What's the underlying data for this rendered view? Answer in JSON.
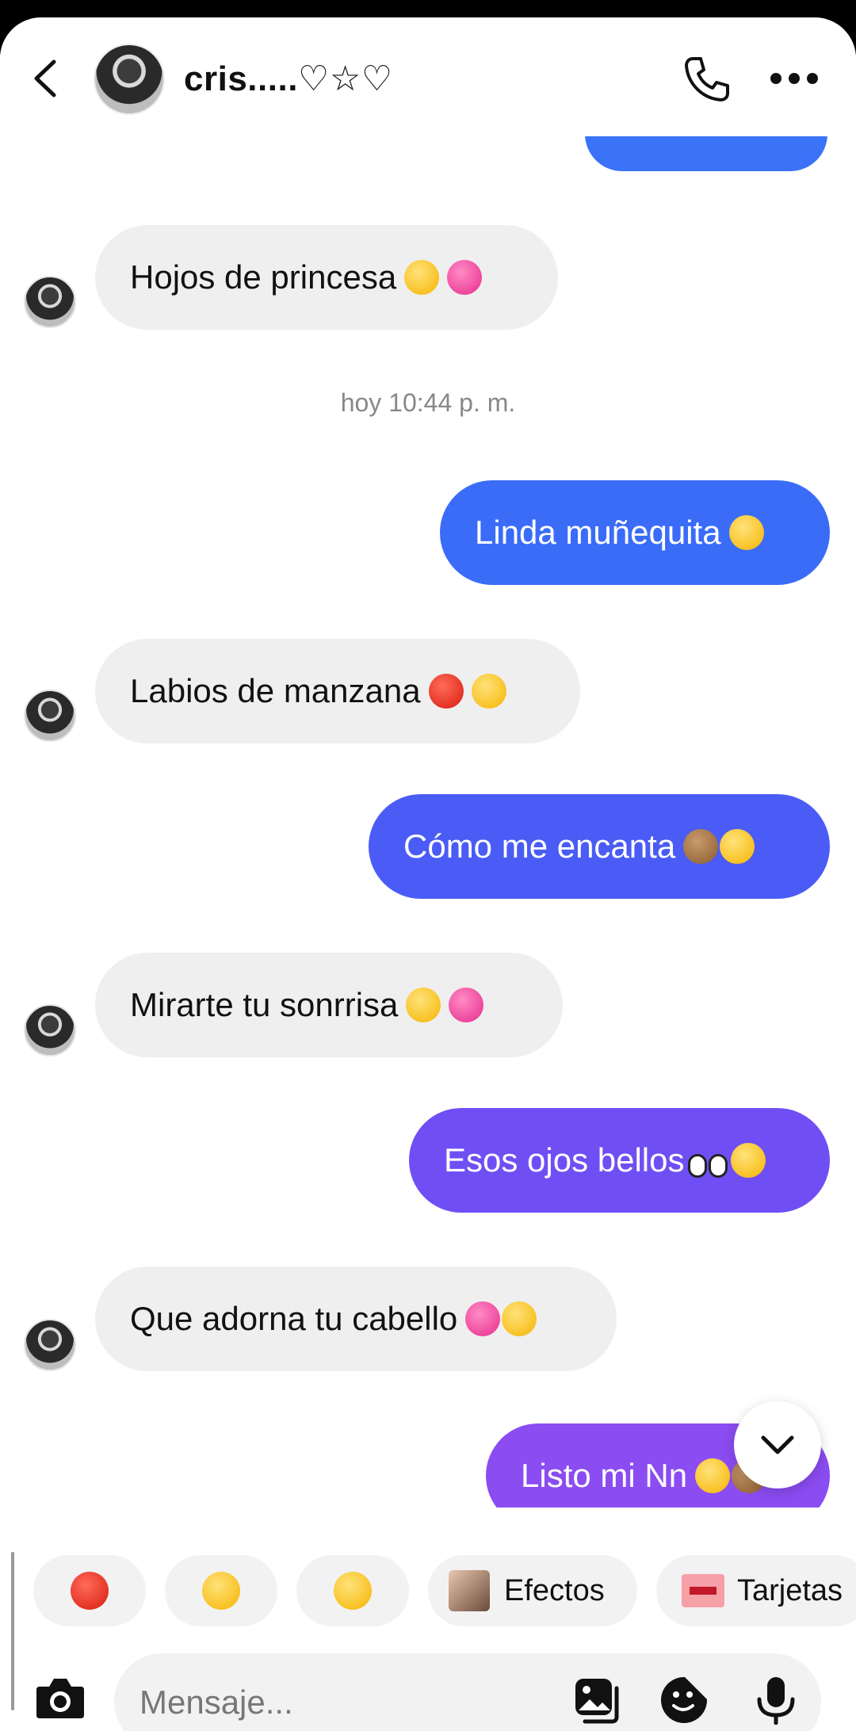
{
  "header": {
    "contact_name": "cris.....♡☆♡"
  },
  "timestamp": "hoy 10:44 p. m.",
  "messages": [
    {
      "from": "them",
      "text": "Hojos de princesa",
      "emojis": [
        "princess-emoji",
        "two-hearts-emoji"
      ]
    },
    {
      "from": "me",
      "text": "Linda muñequita",
      "emojis": [
        "heart-eyes-emoji"
      ]
    },
    {
      "from": "them",
      "text": "Labios de manzana",
      "emojis": [
        "apple-emoji",
        "drooling-emoji"
      ]
    },
    {
      "from": "me",
      "text": "Cómo me encanta",
      "emojis": [
        "see-no-evil-monkey-emoji",
        "heart-eyes-emoji"
      ]
    },
    {
      "from": "them",
      "text": "Mirarte tu sonrrisa",
      "emojis": [
        "smiling-emoji",
        "two-hearts-emoji"
      ]
    },
    {
      "from": "me",
      "text": "Esos ojos bellos",
      "emojis": [
        "eyes-emoji",
        "heart-eyes-emoji"
      ]
    },
    {
      "from": "them",
      "text": "Que adorna tu cabello",
      "emojis": [
        "two-hearts-emoji",
        "kissing-emoji"
      ]
    },
    {
      "from": "me",
      "text": "Listo mi Nn",
      "emojis": [
        "heart-eyes-emoji",
        "monkey-emoji"
      ]
    }
  ],
  "quick_reactions": [
    {
      "icon": "red-heart-emoji"
    },
    {
      "icon": "tears-of-joy-emoji"
    },
    {
      "icon": "thumbs-up-emoji"
    }
  ],
  "chips": {
    "effects_label": "Efectos",
    "cards_label": "Tarjetas"
  },
  "composer": {
    "placeholder": "Mensaje..."
  },
  "colors": {
    "bubble_blue": "#3a72f8",
    "bubble_indigo": "#4a5cf5",
    "bubble_violet": "#6f4ff4",
    "bubble_purple": "#8b4cf1",
    "incoming_bubble": "#efefef"
  }
}
